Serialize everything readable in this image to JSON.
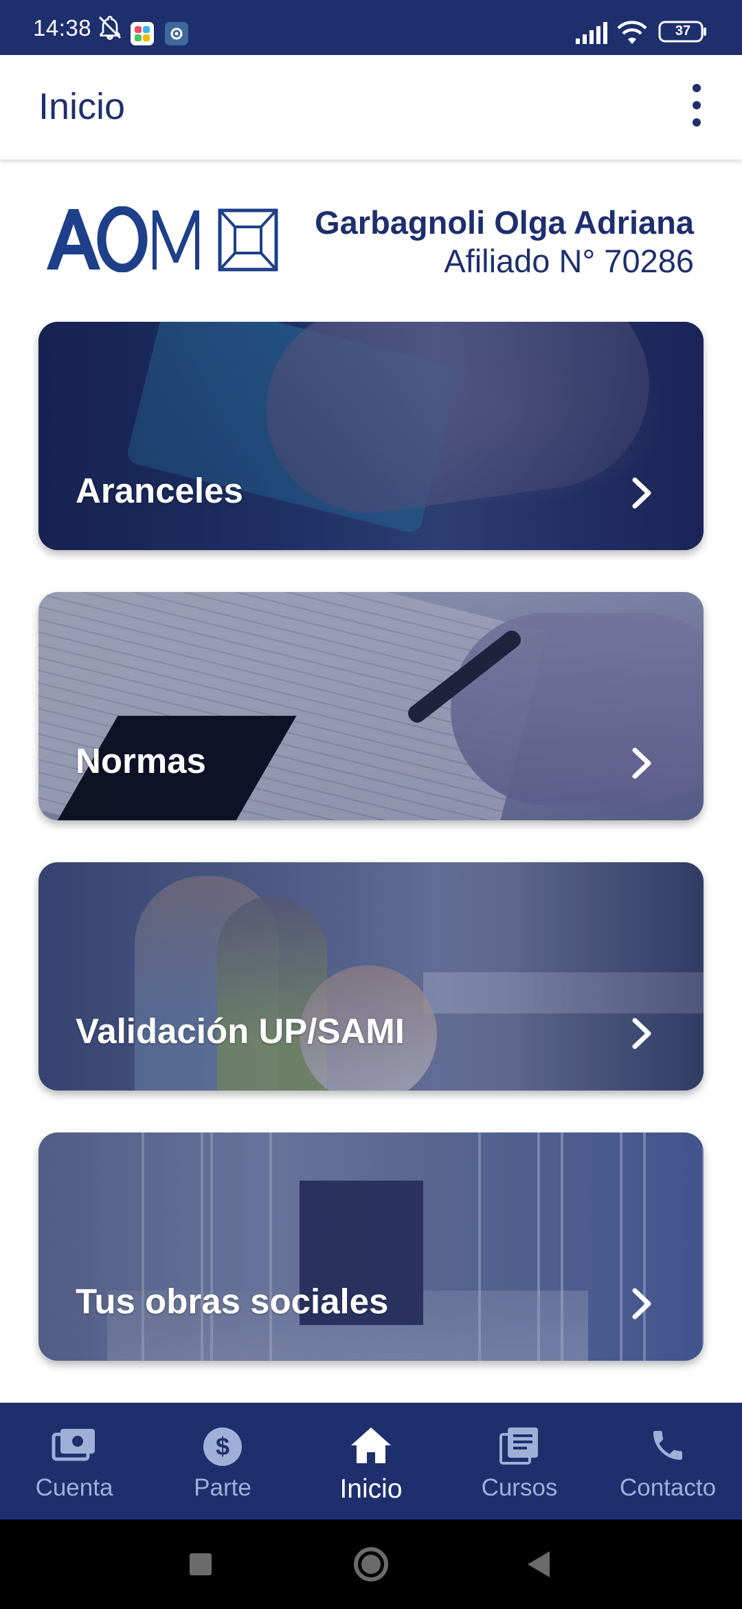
{
  "status_bar": {
    "time": "14:38",
    "battery": "37",
    "icons": [
      "bell-off-icon",
      "app-icon",
      "settings-app-icon",
      "signal-icon",
      "wifi-icon",
      "battery-icon"
    ]
  },
  "app_bar": {
    "title": "Inicio",
    "menu_icon": "more-vert-icon"
  },
  "header": {
    "logo_text": "AOM",
    "user_name": "Garbagnoli Olga Adriana",
    "member_number": "Afiliado N° 70286"
  },
  "cards": [
    {
      "label": "Aranceles",
      "icon": "chevron-right-icon"
    },
    {
      "label": "Normas",
      "icon": "chevron-right-icon"
    },
    {
      "label": "Validación UP/SAMI",
      "icon": "chevron-right-icon"
    },
    {
      "label": "Tus obras sociales",
      "icon": "chevron-right-icon"
    }
  ],
  "bottom_nav": {
    "active": "Inicio",
    "items": [
      {
        "label": "Cuenta",
        "icon": "wallet-icon"
      },
      {
        "label": "Parte",
        "icon": "dollar-icon"
      },
      {
        "label": "Inicio",
        "icon": "home-icon"
      },
      {
        "label": "Cursos",
        "icon": "library-icon"
      },
      {
        "label": "Contacto",
        "icon": "phone-icon"
      }
    ]
  },
  "colors": {
    "primary": "#1e2f6e",
    "nav_inactive": "#9fb0d8",
    "background": "#ffffff"
  }
}
